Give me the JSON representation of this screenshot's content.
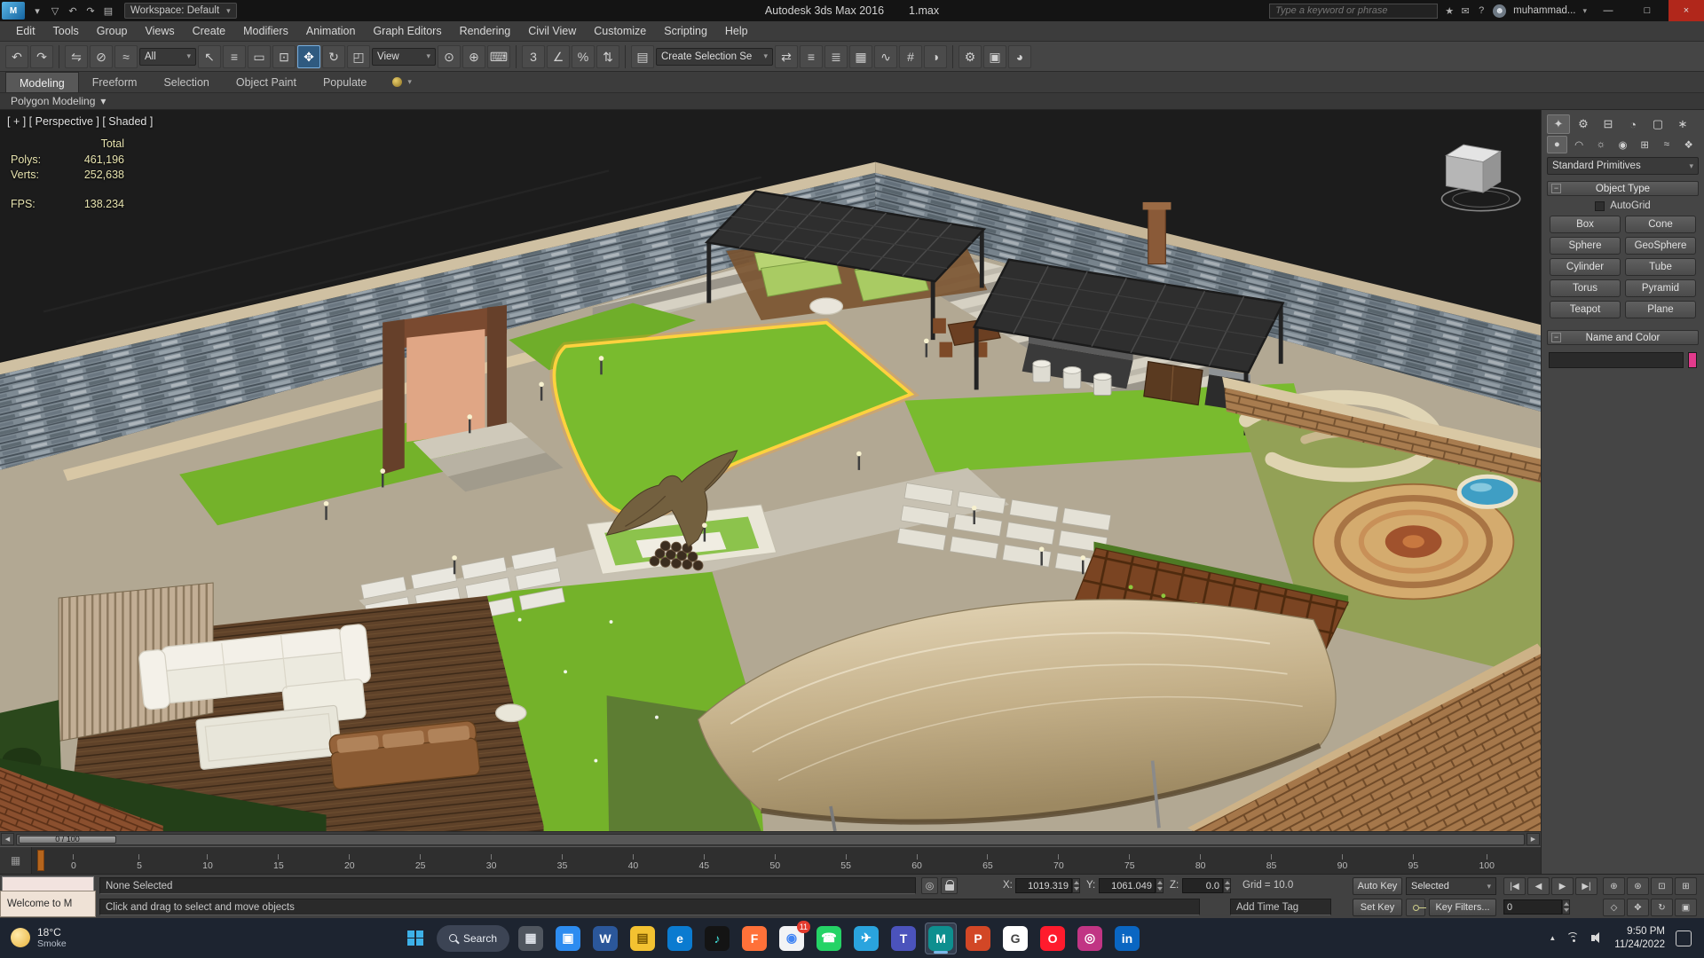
{
  "ui": {
    "chevron_down": "▾",
    "minus": "−",
    "left_arrow": "◀",
    "right_arrow": "▶",
    "checkmark": ""
  },
  "titlebar": {
    "logo_text": "M",
    "app_title": "Autodesk 3ds Max 2016",
    "file_name": "1.max",
    "workspace": "Workspace: Default",
    "search_placeholder": "Type a keyword or phrase",
    "username": "muhammad...",
    "quick_access": [
      {
        "name": "app-menu-chevron-icon",
        "glyph": "▾"
      },
      {
        "name": "save-file-icon",
        "glyph": "▽"
      },
      {
        "name": "undo-icon",
        "glyph": "↶"
      },
      {
        "name": "redo-icon",
        "glyph": "↷"
      },
      {
        "name": "fetch-icon",
        "glyph": "▤"
      }
    ],
    "info_icons": [
      {
        "name": "favorites-icon",
        "glyph": "★"
      },
      {
        "name": "communication-center-icon",
        "glyph": "✉"
      },
      {
        "name": "help-icon",
        "glyph": "?"
      }
    ],
    "avatar_glyph": "☻",
    "window_controls": {
      "minimize": "—",
      "maximize": "□",
      "close": "×"
    }
  },
  "menus": [
    "Edit",
    "Tools",
    "Group",
    "Views",
    "Create",
    "Modifiers",
    "Animation",
    "Graph Editors",
    "Rendering",
    "Civil View",
    "Customize",
    "Scripting",
    "Help"
  ],
  "toolbar": {
    "icons_a": [
      {
        "name": "undo-icon",
        "glyph": "↶"
      },
      {
        "name": "redo-icon",
        "glyph": "↷"
      }
    ],
    "icons_b": [
      {
        "name": "select-and-link-icon",
        "glyph": "⇋"
      },
      {
        "name": "unlink-selection-icon",
        "glyph": "⊘"
      },
      {
        "name": "bind-to-space-warp-icon",
        "glyph": "≈"
      }
    ],
    "filter_dropdown": "All",
    "icons_c": [
      {
        "name": "select-object-icon",
        "glyph": "↖"
      },
      {
        "name": "select-by-name-icon",
        "glyph": "≡"
      },
      {
        "name": "rectangular-selection-region-icon",
        "glyph": "▭"
      },
      {
        "name": "window-crossing-icon",
        "glyph": "⊡"
      }
    ],
    "move_glyph": "✥",
    "icons_d": [
      {
        "name": "select-and-rotate-icon",
        "glyph": "↻"
      },
      {
        "name": "select-and-scale-icon",
        "glyph": "◰"
      }
    ],
    "coord_dropdown": "View",
    "icons_e": [
      {
        "name": "use-pivot-center-icon",
        "glyph": "⊙"
      },
      {
        "name": "select-and-manipulate-icon",
        "glyph": "⊕"
      },
      {
        "name": "keyboard-override-icon",
        "glyph": "⌨"
      }
    ],
    "icons_f": [
      {
        "name": "snap-toggle-3d-icon",
        "glyph": "3"
      },
      {
        "name": "angle-snap-icon",
        "glyph": "∠"
      },
      {
        "name": "percent-snap-icon",
        "glyph": "%"
      },
      {
        "name": "spinner-snap-icon",
        "glyph": "⇅"
      }
    ],
    "icons_g": [
      {
        "name": "edit-named-selection-sets-icon",
        "glyph": "▤"
      }
    ],
    "selection_set_dropdown": "Create Selection Se",
    "icons_h": [
      {
        "name": "mirror-icon",
        "glyph": "⇄"
      },
      {
        "name": "align-icon",
        "glyph": "≡"
      },
      {
        "name": "layer-manager-icon",
        "glyph": "≣"
      },
      {
        "name": "ribbon-toggle-icon",
        "glyph": "▦"
      },
      {
        "name": "curve-editor-icon",
        "glyph": "∿"
      },
      {
        "name": "schematic-view-icon",
        "glyph": "#"
      },
      {
        "name": "material-editor-icon",
        "glyph": "◑"
      }
    ],
    "icons_i": [
      {
        "name": "render-setup-icon",
        "glyph": "⚙"
      },
      {
        "name": "rendered-frame-window-icon",
        "glyph": "▣"
      },
      {
        "name": "render-production-icon",
        "glyph": "◕"
      }
    ]
  },
  "ribbon": {
    "tabs": [
      {
        "label": "Modeling",
        "active": true
      },
      {
        "label": "Freeform"
      },
      {
        "label": "Selection"
      },
      {
        "label": "Object Paint"
      },
      {
        "label": "Populate"
      }
    ],
    "sub_label": "Polygon Modeling"
  },
  "viewport": {
    "label": "[ + ] [ Perspective ] [ Shaded ]",
    "stats": {
      "total_label": "Total",
      "polys_label": "Polys:",
      "polys_value": "461,196",
      "verts_label": "Verts:",
      "verts_value": "252,638",
      "fps_label": "FPS:",
      "fps_value": "138.234"
    }
  },
  "command_panel": {
    "tabs": [
      {
        "name": "create-tab-icon",
        "glyph": "✦",
        "active": true
      },
      {
        "name": "modify-tab-icon",
        "glyph": "⚙"
      },
      {
        "name": "hierarchy-tab-icon",
        "glyph": "⊟"
      },
      {
        "name": "motion-tab-icon",
        "glyph": "◔"
      },
      {
        "name": "display-tab-icon",
        "glyph": "▢"
      },
      {
        "name": "utilities-tab-icon",
        "glyph": "∗"
      }
    ],
    "categories": [
      {
        "name": "geometry-category-icon",
        "glyph": "●",
        "active": true
      },
      {
        "name": "shapes-category-icon",
        "glyph": "◠"
      },
      {
        "name": "lights-category-icon",
        "glyph": "☼"
      },
      {
        "name": "cameras-category-icon",
        "glyph": "◉"
      },
      {
        "name": "helpers-category-icon",
        "glyph": "⊞"
      },
      {
        "name": "space-warps-category-icon",
        "glyph": "≈"
      },
      {
        "name": "systems-category-icon",
        "glyph": "❖"
      }
    ],
    "dropdown": "Standard Primitives",
    "object_type": {
      "title": "Object Type",
      "autogrid": "AutoGrid",
      "buttons": [
        "Box",
        "Cone",
        "Sphere",
        "GeoSphere",
        "Cylinder",
        "Tube",
        "Torus",
        "Pyramid",
        "Teapot",
        "Plane"
      ]
    },
    "name_color": {
      "title": "Name and Color",
      "swatch_style": "background:#e23a8c"
    }
  },
  "timeline": {
    "handle": "0 / 100",
    "mini_icon": "▦",
    "ticks": [
      "0",
      "5",
      "10",
      "15",
      "20",
      "25",
      "30",
      "35",
      "40",
      "45",
      "50",
      "55",
      "60",
      "65",
      "70",
      "75",
      "80",
      "85",
      "90",
      "95",
      "100"
    ]
  },
  "statusbar": {
    "selection": "None Selected",
    "prompt": "Click and drag to select and move objects",
    "welcome": "Welcome to M",
    "isolate_glyph": "◎",
    "coords": {
      "x_label": "X:",
      "x": "1019.319",
      "y_label": "Y:",
      "y": "1061.049",
      "z_label": "Z:",
      "z": "0.0"
    },
    "grid": "Grid = 10.0",
    "time_tag": "Add Time Tag",
    "auto_key": "Auto Key",
    "set_key": "Set Key",
    "key_filters": "Key Filters...",
    "selected_dropdown": "Selected",
    "frame": "0",
    "playback": [
      {
        "name": "go-to-start-button",
        "glyph": "|◀"
      },
      {
        "name": "previous-frame-button",
        "glyph": "◀"
      },
      {
        "name": "play-button",
        "glyph": "▶"
      },
      {
        "name": "go-to-end-button",
        "glyph": "▶|"
      }
    ],
    "nav_row1": [
      {
        "name": "zoom-icon",
        "glyph": "⊕"
      },
      {
        "name": "zoom-all-icon",
        "glyph": "⊛"
      },
      {
        "name": "zoom-extents-icon",
        "glyph": "⊡"
      },
      {
        "name": "zoom-region-icon",
        "glyph": "⊞"
      }
    ],
    "nav_row2": [
      {
        "name": "field-of-view-icon",
        "glyph": "◇"
      },
      {
        "name": "pan-view-icon",
        "glyph": "✥"
      },
      {
        "name": "orbit-icon",
        "glyph": "↻"
      },
      {
        "name": "maximize-viewport-icon",
        "glyph": "▣"
      }
    ]
  },
  "taskbar": {
    "weather_temp": "18°C",
    "weather_desc": "Smoke",
    "search_label": "Search",
    "tray_chevron": "▲",
    "time": "9:50 PM",
    "date": "11/24/2022",
    "apps": [
      {
        "name": "taskbar-app-task-view",
        "color": "#50565f",
        "glyph": "▦",
        "fg": "#dfe3ea"
      },
      {
        "name": "taskbar-app-camera",
        "color": "#2d8cf0",
        "glyph": "▣",
        "fg": "#ffffff"
      },
      {
        "name": "taskbar-app-word",
        "color": "#2b579a",
        "glyph": "W",
        "fg": "#ffffff"
      },
      {
        "name": "taskbar-app-file-explorer",
        "color": "#f3c231",
        "glyph": "▤",
        "fg": "#7a5800"
      },
      {
        "name": "taskbar-app-edge",
        "color": "#0b7bd0",
        "glyph": "e",
        "fg": "#ffffff"
      },
      {
        "name": "taskbar-app-tiktok",
        "color": "#141414",
        "glyph": "♪",
        "fg": "#43e6e0"
      },
      {
        "name": "taskbar-app-firefox",
        "color": "#ff7139",
        "glyph": "F",
        "fg": "#ffffff"
      },
      {
        "name": "taskbar-app-chrome",
        "color": "#f2f3f5",
        "glyph": "◉",
        "fg": "#4285f4",
        "badge": "11"
      },
      {
        "name": "taskbar-app-whatsapp",
        "color": "#25d366",
        "glyph": "☎",
        "fg": "#ffffff"
      },
      {
        "name": "taskbar-app-telegram",
        "color": "#2aa4de",
        "glyph": "✈",
        "fg": "#ffffff"
      },
      {
        "name": "taskbar-app-teams",
        "color": "#4b53bc",
        "glyph": "T",
        "fg": "#ffffff"
      },
      {
        "name": "taskbar-app-3ds-max",
        "color": "#0e8f8f",
        "glyph": "M",
        "fg": "#ffffff",
        "active": true
      },
      {
        "name": "taskbar-app-powerpoint",
        "color": "#d24726",
        "glyph": "P",
        "fg": "#ffffff"
      },
      {
        "name": "taskbar-app-google",
        "color": "#ffffff",
        "glyph": "G",
        "fg": "#444444"
      },
      {
        "name": "taskbar-app-opera",
        "color": "#ff1b2d",
        "glyph": "O",
        "fg": "#ffffff"
      },
      {
        "name": "taskbar-app-instagram",
        "color": "#c13584",
        "glyph": "◎",
        "fg": "#ffffff"
      },
      {
        "name": "taskbar-app-linkedin",
        "color": "#0a66c2",
        "glyph": "in",
        "fg": "#ffffff"
      }
    ]
  }
}
